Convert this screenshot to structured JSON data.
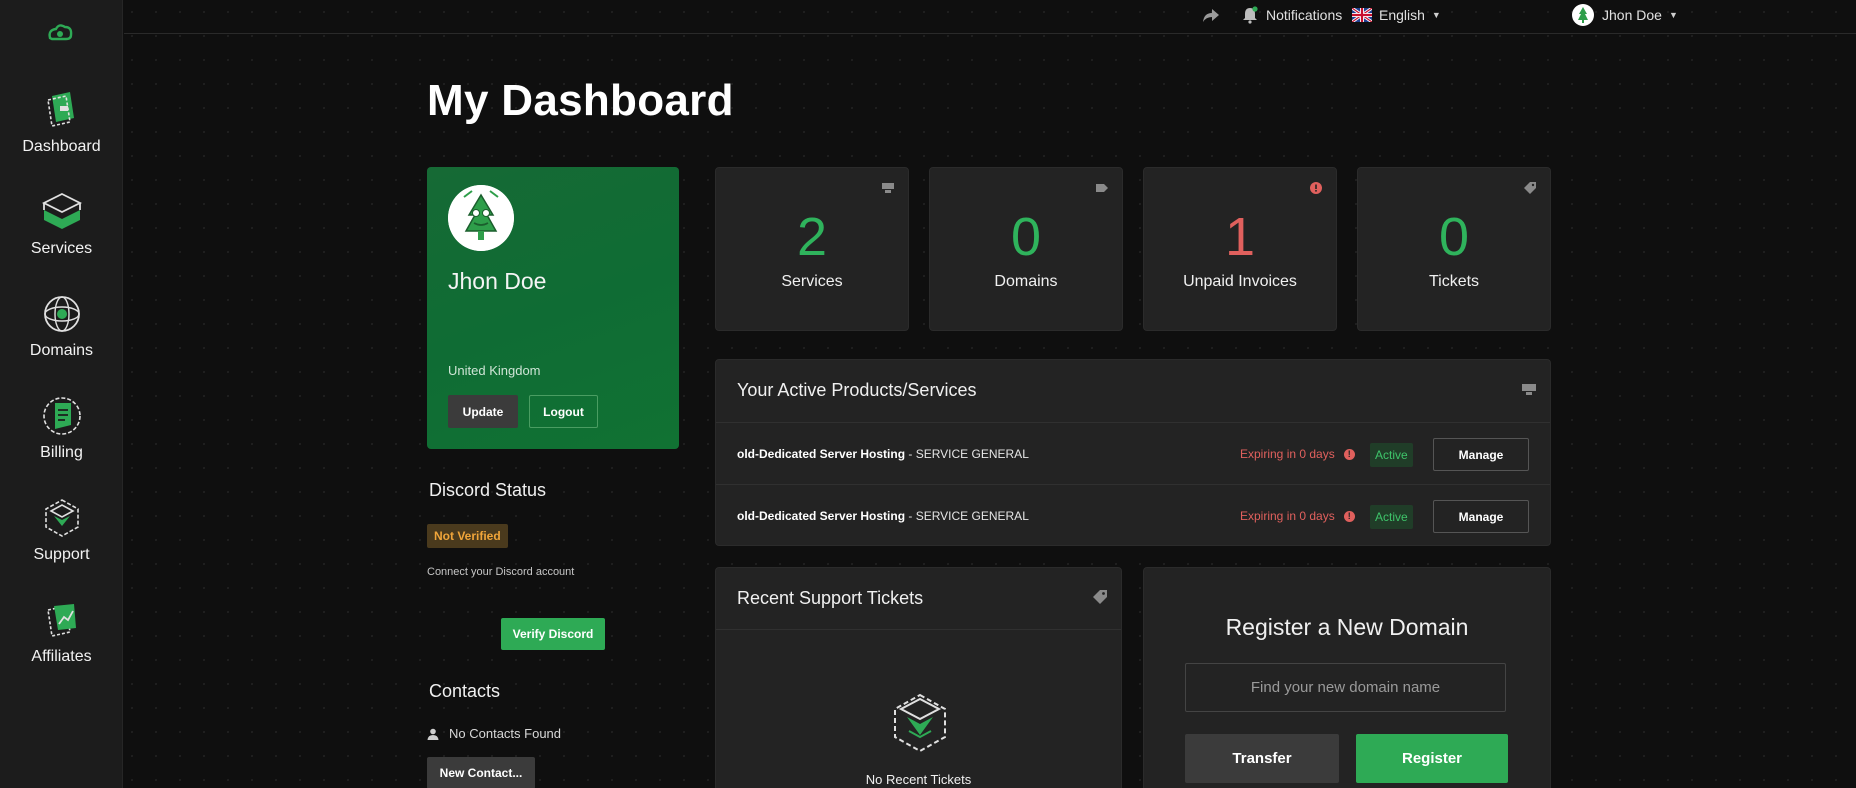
{
  "sidebar": {
    "items": [
      {
        "label": "Dashboard",
        "icon": "dashboard-icon"
      },
      {
        "label": "Services",
        "icon": "services-icon"
      },
      {
        "label": "Domains",
        "icon": "globe-icon"
      },
      {
        "label": "Billing",
        "icon": "billing-icon"
      },
      {
        "label": "Support",
        "icon": "support-icon"
      },
      {
        "label": "Affiliates",
        "icon": "affiliates-icon"
      }
    ]
  },
  "topbar": {
    "notifications_label": "Notifications",
    "language_label": "English",
    "user_label": "Jhon Doe"
  },
  "page_title": "My Dashboard",
  "profile": {
    "name": "Jhon Doe",
    "country": "United Kingdom",
    "update_label": "Update",
    "logout_label": "Logout"
  },
  "discord": {
    "title": "Discord Status",
    "status": "Not Verified",
    "hint": "Connect your Discord account",
    "verify_label": "Verify Discord"
  },
  "contacts": {
    "title": "Contacts",
    "empty_text": "No Contacts Found",
    "new_label": "New Contact..."
  },
  "stats": [
    {
      "value": "2",
      "label": "Services"
    },
    {
      "value": "0",
      "label": "Domains"
    },
    {
      "value": "1",
      "label": "Unpaid Invoices"
    },
    {
      "value": "0",
      "label": "Tickets"
    }
  ],
  "colors": {
    "accent_green": "#2eaa55",
    "alert_red": "#e0605d",
    "profile_green": "#0f6c34"
  },
  "active_services": {
    "title": "Your Active Products/Services",
    "rows": [
      {
        "product": "old-Dedicated Server Hosting",
        "group": " - SERVICE GENERAL",
        "expiry": "Expiring in 0 days",
        "status": "Active",
        "action": "Manage"
      },
      {
        "product": "old-Dedicated Server Hosting",
        "group": " - SERVICE GENERAL",
        "expiry": "Expiring in 0 days",
        "status": "Active",
        "action": "Manage"
      }
    ]
  },
  "tickets": {
    "title": "Recent Support Tickets",
    "empty_text": "No Recent Tickets"
  },
  "domain_register": {
    "title": "Register a New Domain",
    "placeholder": "Find your new domain name",
    "transfer_label": "Transfer",
    "register_label": "Register"
  }
}
